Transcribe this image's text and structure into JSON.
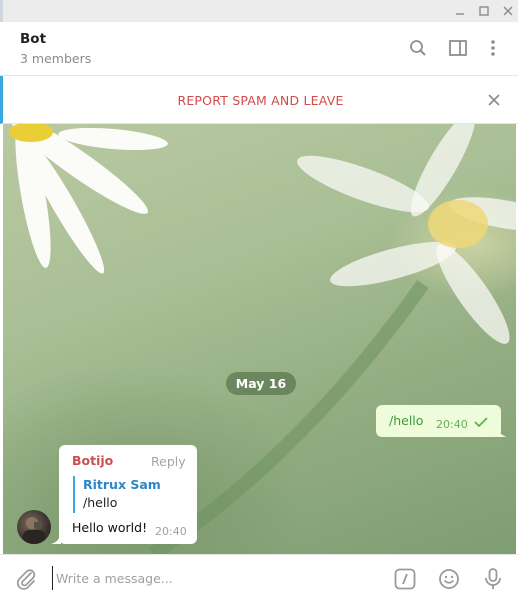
{
  "window": {
    "minimize_symbol": "—",
    "maximize_symbol": "☐",
    "close_symbol": "✕"
  },
  "header": {
    "title": "Bot",
    "subtitle": "3 members",
    "icons": [
      "search-icon",
      "sidebar-panel-icon",
      "more-vertical-icon"
    ]
  },
  "spam_bar": {
    "label": "REPORT SPAM AND LEAVE",
    "close_icon": "close-icon",
    "accent_color": "#3aa7e2",
    "label_color": "#d24b4b"
  },
  "chat": {
    "date_label": "May 16",
    "messages": [
      {
        "direction": "outgoing",
        "text": "/hello",
        "time": "20:40",
        "status_icon": "check-icon"
      },
      {
        "direction": "incoming",
        "author": "Botijo",
        "reply_label": "Reply",
        "quote": {
          "author": "Ritrux Sam",
          "text": "/hello"
        },
        "text": "Hello world!",
        "time": "20:40"
      }
    ]
  },
  "composer": {
    "placeholder": "Write a message...",
    "value": "",
    "command_symbol": "/",
    "icons": [
      "paperclip-icon",
      "bot-command-icon",
      "emoji-icon",
      "microphone-icon"
    ]
  }
}
